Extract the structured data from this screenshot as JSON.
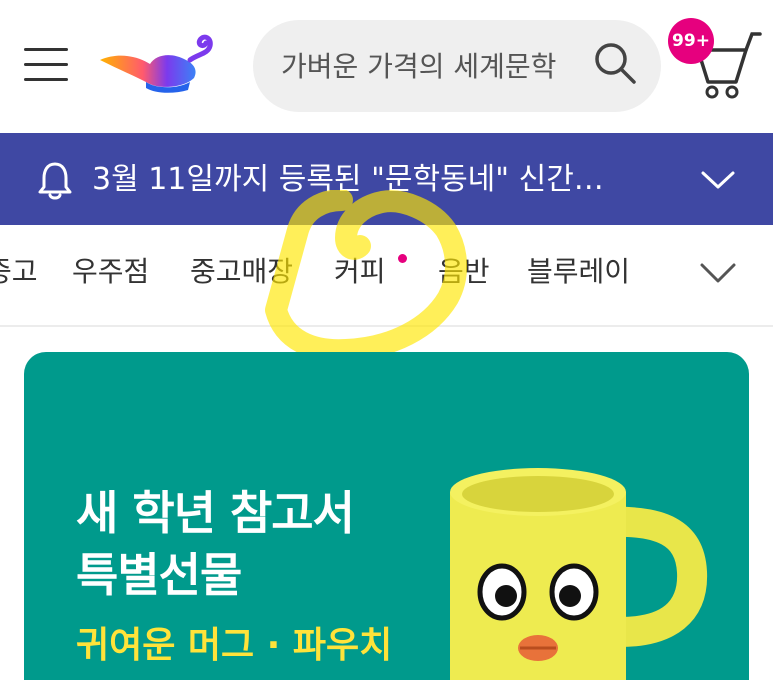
{
  "header": {
    "search": {
      "placeholder": "가벼운 가격의 세계문학",
      "value": ""
    },
    "cart_badge": "99+"
  },
  "notice": {
    "text": "3월 11일까지 등록된 \"문학동네\" 신간…"
  },
  "tabs": [
    {
      "label": "중고"
    },
    {
      "label": "우주점"
    },
    {
      "label": "중고매장"
    },
    {
      "label": "커피",
      "has_new_dot": true
    },
    {
      "label": "음반"
    },
    {
      "label": "블루레이"
    }
  ],
  "banner": {
    "title_line1": "새 학년 참고서",
    "title_line2": "특별선물",
    "subtitle": "귀여운 머그 · 파우치"
  },
  "colors": {
    "notice_bg": "#3f48a3",
    "badge": "#e6007e",
    "banner_bg": "#009a8c",
    "banner_subtitle": "#ffe33a",
    "annotation": "#ffe600"
  },
  "icons": [
    "menu-icon",
    "aladin-lamp-logo",
    "search-icon",
    "cart-icon",
    "bell-icon",
    "chevron-down-icon",
    "mug-image"
  ]
}
